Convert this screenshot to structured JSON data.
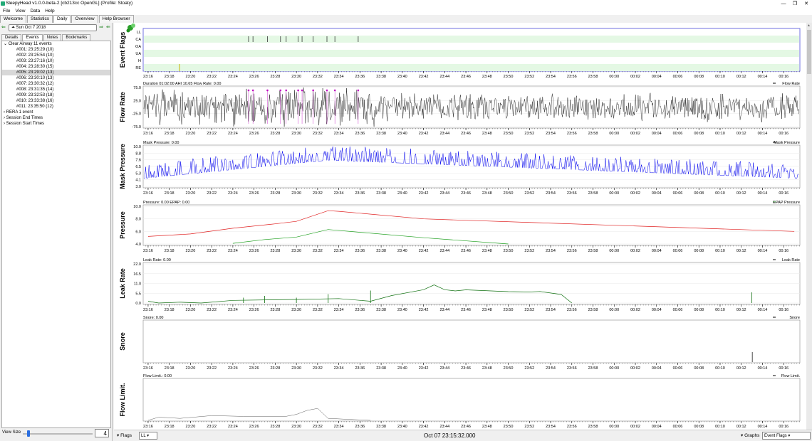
{
  "window": {
    "title": "SleepyHead v1.0.0-beta-2 [cb213cc OpenGL] (Profile: Stoaty)",
    "buttons": [
      "—",
      "❐",
      "✕"
    ]
  },
  "menu": [
    "File",
    "View",
    "Data",
    "Help"
  ],
  "main_tabs": [
    {
      "label": "Welcome",
      "active": false
    },
    {
      "label": "Statistics",
      "active": false
    },
    {
      "label": "Daily",
      "active": true
    },
    {
      "label": "Overview",
      "active": false
    },
    {
      "label": "Help Browser",
      "active": false
    }
  ],
  "left": {
    "date": "Sun Oct 7 2018",
    "subtabs": [
      {
        "label": "Details",
        "active": false
      },
      {
        "label": "Events",
        "active": true
      },
      {
        "label": "Notes",
        "active": false
      },
      {
        "label": "Bookmarks",
        "active": false
      }
    ],
    "tree": [
      {
        "text": "Clear Airway 11 events",
        "level": 0,
        "toggle": "⌄",
        "selected": false
      },
      {
        "text": "#001: 23:25:29 (10)",
        "level": 1,
        "selected": false
      },
      {
        "text": "#002: 23:25:54 (10)",
        "level": 1,
        "selected": false
      },
      {
        "text": "#003: 23:27:16 (10)",
        "level": 1,
        "selected": false
      },
      {
        "text": "#004: 23:28:30 (15)",
        "level": 1,
        "selected": false
      },
      {
        "text": "#005: 23:29:02 (13)",
        "level": 1,
        "selected": true
      },
      {
        "text": "#006: 23:30:10 (13)",
        "level": 1,
        "selected": false
      },
      {
        "text": "#007: 23:30:32 (12)",
        "level": 1,
        "selected": false
      },
      {
        "text": "#008: 23:31:35 (14)",
        "level": 1,
        "selected": false
      },
      {
        "text": "#009: 23:32:53 (18)",
        "level": 1,
        "selected": false
      },
      {
        "text": "#010: 23:33:38 (16)",
        "level": 1,
        "selected": false
      },
      {
        "text": "#011: 23:35:50 (12)",
        "level": 1,
        "selected": false
      },
      {
        "text": "RERA 1 event",
        "level": 0,
        "toggle": "›",
        "selected": false
      },
      {
        "text": "Session End Times",
        "level": 0,
        "toggle": "›",
        "selected": false
      },
      {
        "text": "Session Start Times",
        "level": 0,
        "toggle": "›",
        "selected": false
      }
    ],
    "view_size_label": "View Size",
    "view_size_value": "4",
    "slider_fraction": 0.06
  },
  "bottom": {
    "flags_label": "Flags",
    "flag_combo": "LL",
    "timestamp": "Oct 07 23:15:32.000",
    "graphs_label": "Graphs",
    "graphs_combo": "Event Flags"
  },
  "colors": {
    "flow": "#000000",
    "mask": "#0000ee",
    "pressure": "#e02020",
    "epap": "#20a020",
    "leak": "#107010",
    "snore": "#808080",
    "flowlimit": "#606060",
    "flag_bg": "#e4f8e4",
    "flag_panel_border": "#7070e0",
    "marker": "#c000c0"
  },
  "x_ticks": [
    "23:16",
    "23:18",
    "23:20",
    "23:22",
    "23:24",
    "23:26",
    "23:28",
    "23:30",
    "23:32",
    "23:34",
    "23:36",
    "23:38",
    "23:40",
    "23:42",
    "23:44",
    "23:46",
    "23:48",
    "23:50",
    "23:52",
    "23:54",
    "23:56",
    "23:58",
    "00:00",
    "00:02",
    "00:04",
    "00:06",
    "00:08",
    "00:10",
    "00:12",
    "00:14",
    "00:16"
  ],
  "graphs": [
    {
      "id": "event-flags",
      "ylabel": "Event Flags",
      "header": "",
      "legend": "",
      "flag_rows": [
        "LL",
        "CA",
        "OA",
        "UA",
        "H",
        "RE"
      ],
      "ca_event_times": [
        "23:25:29",
        "23:25:54",
        "23:27:16",
        "23:28:30",
        "23:29:02",
        "23:30:10",
        "23:30:32",
        "23:31:35",
        "23:32:53",
        "23:33:38",
        "23:35:50"
      ]
    },
    {
      "id": "flow-rate",
      "ylabel": "Flow Rate",
      "header": "Duration 01:02:00 AHI 10.65 Flow Rate: 0.00",
      "legend": "Flow Rate",
      "yticks": [
        "75.0",
        "25.0",
        "-25.0",
        "-75.0"
      ]
    },
    {
      "id": "mask-pressure",
      "ylabel": "Mask Pressure",
      "header": "Mask Pressure: 0.00",
      "legend": "Mask Pressure",
      "yticks": [
        "10.0",
        "8.8",
        "7.6",
        "6.5",
        "5.3",
        "4.1",
        "3.0"
      ]
    },
    {
      "id": "pressure",
      "ylabel": "Pressure",
      "header": "Pressure: 0.00 EPAP: 0.00",
      "legend": "EPAP Pressure",
      "yticks": [
        "10.0",
        "8.0",
        "6.0",
        "4.0"
      ]
    },
    {
      "id": "leak-rate",
      "ylabel": "Leak Rate",
      "header": "Leak Rate: 0.00",
      "legend": "Leak Rate",
      "yticks": [
        "22.0",
        "16.5",
        "11.0",
        "5.5",
        "0.0"
      ]
    },
    {
      "id": "snore",
      "ylabel": "Snore",
      "header": "Snore: 0.00",
      "legend": "Snore",
      "yticks": []
    },
    {
      "id": "flow-limit",
      "ylabel": "Flow Limit.",
      "header": "Flow Limit.: 0.00",
      "legend": "Flow Limit.",
      "yticks": []
    }
  ]
}
